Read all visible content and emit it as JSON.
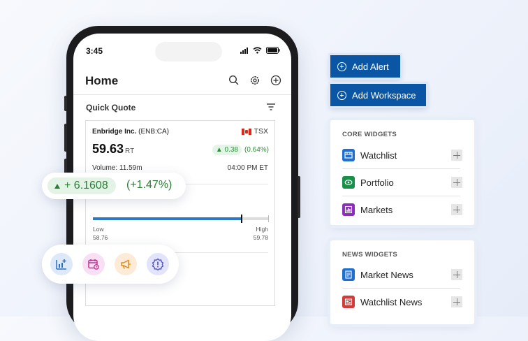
{
  "phone": {
    "status_time": "3:45",
    "header": {
      "title": "Home"
    },
    "quick_quote": {
      "title": "Quick Quote",
      "company": "Enbridge Inc.",
      "ticker": "(ENB:CA)",
      "exchange": "TSX",
      "price": "59.63",
      "price_suffix": "RT",
      "change": "0.38",
      "change_pct": "(0.64%)",
      "volume": "Volume: 11.59m",
      "time": "04:00 PM ET",
      "day_range": {
        "low_label": "Low",
        "low_value": "58.76",
        "high_label": "High",
        "high_value": "59.78",
        "position": 0.85
      }
    }
  },
  "floating_change": {
    "value": "+ 6.1608",
    "pct": "(+1.47%)"
  },
  "floating_icons": [
    {
      "name": "chart-add-icon",
      "bg": "#dde8f8",
      "color": "#2a6fc0"
    },
    {
      "name": "calendar-clock-icon",
      "bg": "#f8dff3",
      "color": "#c0348f"
    },
    {
      "name": "megaphone-icon",
      "bg": "#fdebd7",
      "color": "#e08a18"
    },
    {
      "name": "alert-icon",
      "bg": "#e3e4fb",
      "color": "#4450c8"
    }
  ],
  "actions": {
    "add_alert": "Add Alert",
    "add_workspace": "Add Workspace"
  },
  "core_widgets": {
    "title": "CORE WIDGETS",
    "items": [
      {
        "label": "Watchlist",
        "icon": "watchlist-icon",
        "color": "#1f6fd1"
      },
      {
        "label": "Portfolio",
        "icon": "portfolio-icon",
        "color": "#17914a"
      },
      {
        "label": "Markets",
        "icon": "markets-icon",
        "color": "#8b2fb8"
      }
    ]
  },
  "news_widgets": {
    "title": "NEWS WIDGETS",
    "items": [
      {
        "label": "Market News",
        "icon": "market-news-icon",
        "color": "#1f6fd1"
      },
      {
        "label": "Watchlist News",
        "icon": "watchlist-news-icon",
        "color": "#d33a3a"
      }
    ]
  }
}
